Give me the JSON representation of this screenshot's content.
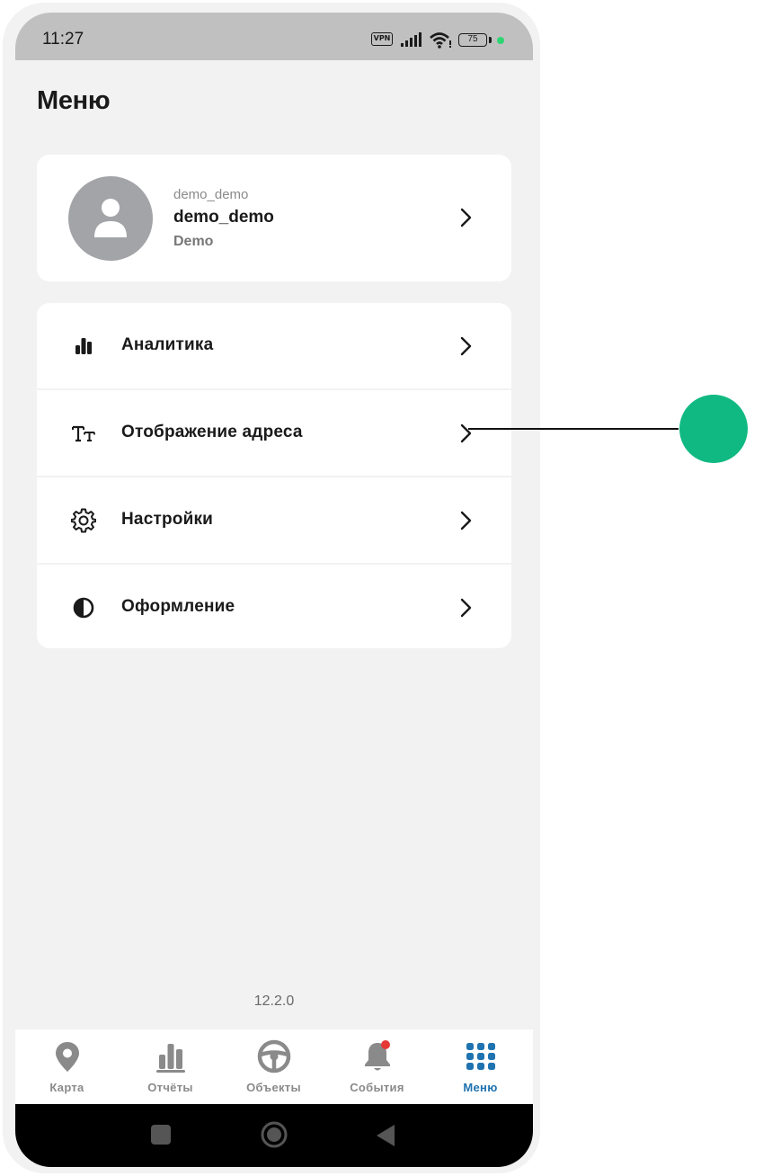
{
  "status_bar": {
    "time": "11:27",
    "vpn": "VPN",
    "battery": "75",
    "indicator_color": "#2ed573"
  },
  "page": {
    "title": "Меню",
    "version": "12.2.0"
  },
  "profile": {
    "login": "demo_demo",
    "name": "demo_demo",
    "organization": "Demo"
  },
  "menu": {
    "items": [
      {
        "label": "Аналитика",
        "icon": "bar-chart-icon"
      },
      {
        "label": "Отображение адреса",
        "icon": "text-size-icon"
      },
      {
        "label": "Настройки",
        "icon": "gear-icon"
      },
      {
        "label": "Оформление",
        "icon": "contrast-icon"
      }
    ]
  },
  "tabs": [
    {
      "label": "Карта",
      "icon": "map-pin-icon",
      "active": false
    },
    {
      "label": "Отчёты",
      "icon": "bar-chart-icon",
      "active": false
    },
    {
      "label": "Объекты",
      "icon": "steering-wheel-icon",
      "active": false
    },
    {
      "label": "События",
      "icon": "bell-icon",
      "active": false,
      "badge": true
    },
    {
      "label": "Меню",
      "icon": "grid-icon",
      "active": true
    }
  ],
  "colors": {
    "accent": "#1f73b0",
    "inactive": "#8a8a8a",
    "badge": "#e53935",
    "annotation": "#10b981"
  }
}
